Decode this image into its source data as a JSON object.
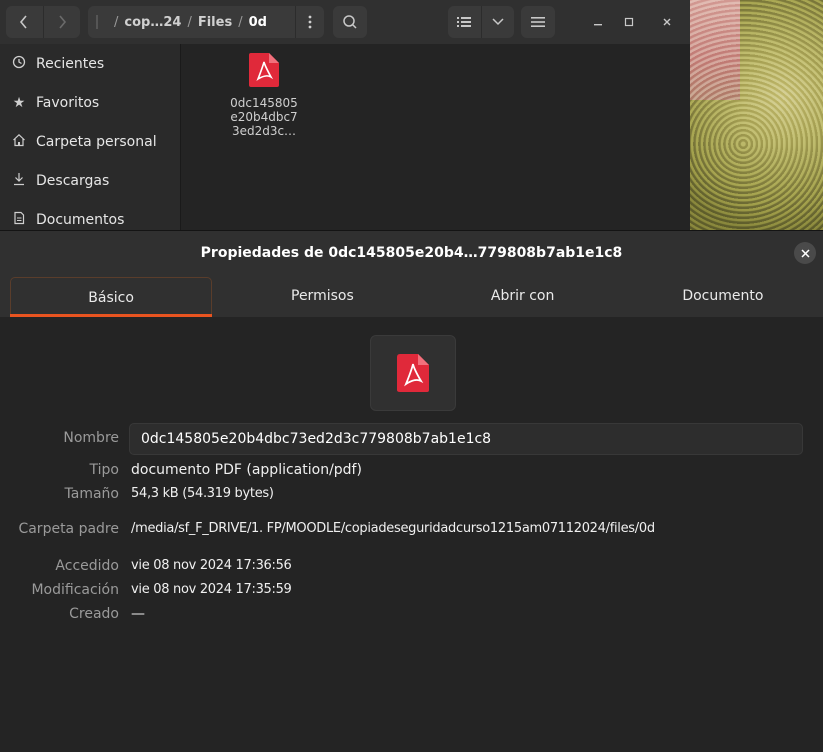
{
  "files_window": {
    "path": {
      "segments": [
        "cop…24",
        "Files",
        "0d"
      ]
    },
    "sidebar": {
      "items": [
        {
          "icon": "clock-icon",
          "label": "Recientes"
        },
        {
          "icon": "star-icon",
          "label": "Favoritos"
        },
        {
          "icon": "home-icon",
          "label": "Carpeta personal"
        },
        {
          "icon": "download-icon",
          "label": "Descargas"
        },
        {
          "icon": "document-icon",
          "label": "Documentos"
        }
      ]
    },
    "file": {
      "label_lines": [
        "0dc145805",
        "e20b4dbc7",
        "3ed2d3c…"
      ]
    }
  },
  "dialog": {
    "title": "Propiedades de 0dc145805e20b4…779808b7ab1e1c8",
    "tabs": [
      {
        "label": "Básico",
        "active": true
      },
      {
        "label": "Permisos",
        "active": false
      },
      {
        "label": "Abrir con",
        "active": false
      },
      {
        "label": "Documento",
        "active": false
      }
    ],
    "fields": {
      "nombre": {
        "label": "Nombre",
        "value": "0dc145805e20b4dbc73ed2d3c779808b7ab1e1c8"
      },
      "tipo": {
        "label": "Tipo",
        "value": "documento PDF (application/pdf)"
      },
      "tamano": {
        "label": "Tamaño",
        "value": "54,3 kB (54.319 bytes)"
      },
      "carpeta": {
        "label": "Carpeta padre",
        "value": "/media/sf_F_DRIVE/1. FP/MOODLE/copiadeseguridadcurso1215am07112024/files/0d"
      },
      "accedido": {
        "label": "Accedido",
        "value": "vie 08 nov 2024 17:36:56"
      },
      "modificacion": {
        "label": "Modificación",
        "value": "vie 08 nov 2024 17:35:59"
      },
      "creado": {
        "label": "Creado",
        "value": "—"
      }
    }
  },
  "colors": {
    "accent": "#e95420",
    "pdf_red": "#e0293a"
  }
}
